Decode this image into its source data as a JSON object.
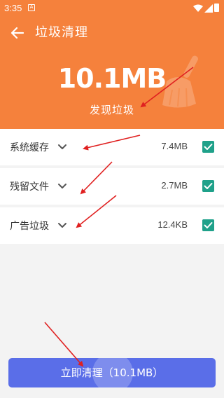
{
  "status": {
    "time": "3:35",
    "notif_glyph": "A"
  },
  "header": {
    "title": "垃圾清理",
    "total_size": "10.1MB",
    "found_label": "发现垃圾",
    "accent_color": "#f5813c"
  },
  "items": [
    {
      "label": "系统缓存",
      "size": "7.4MB",
      "checked": true
    },
    {
      "label": "残留文件",
      "size": "2.7MB",
      "checked": true
    },
    {
      "label": "广告垃圾",
      "size": "12.4KB",
      "checked": true
    }
  ],
  "cta": {
    "label": "立即清理（10.1MB）",
    "color": "#5a6ee8"
  },
  "icons": [
    "back-arrow-icon",
    "broom-icon",
    "chevron-down-icon",
    "checkbox-checked-icon",
    "wifi-icon",
    "signal-icon",
    "battery-icon"
  ]
}
